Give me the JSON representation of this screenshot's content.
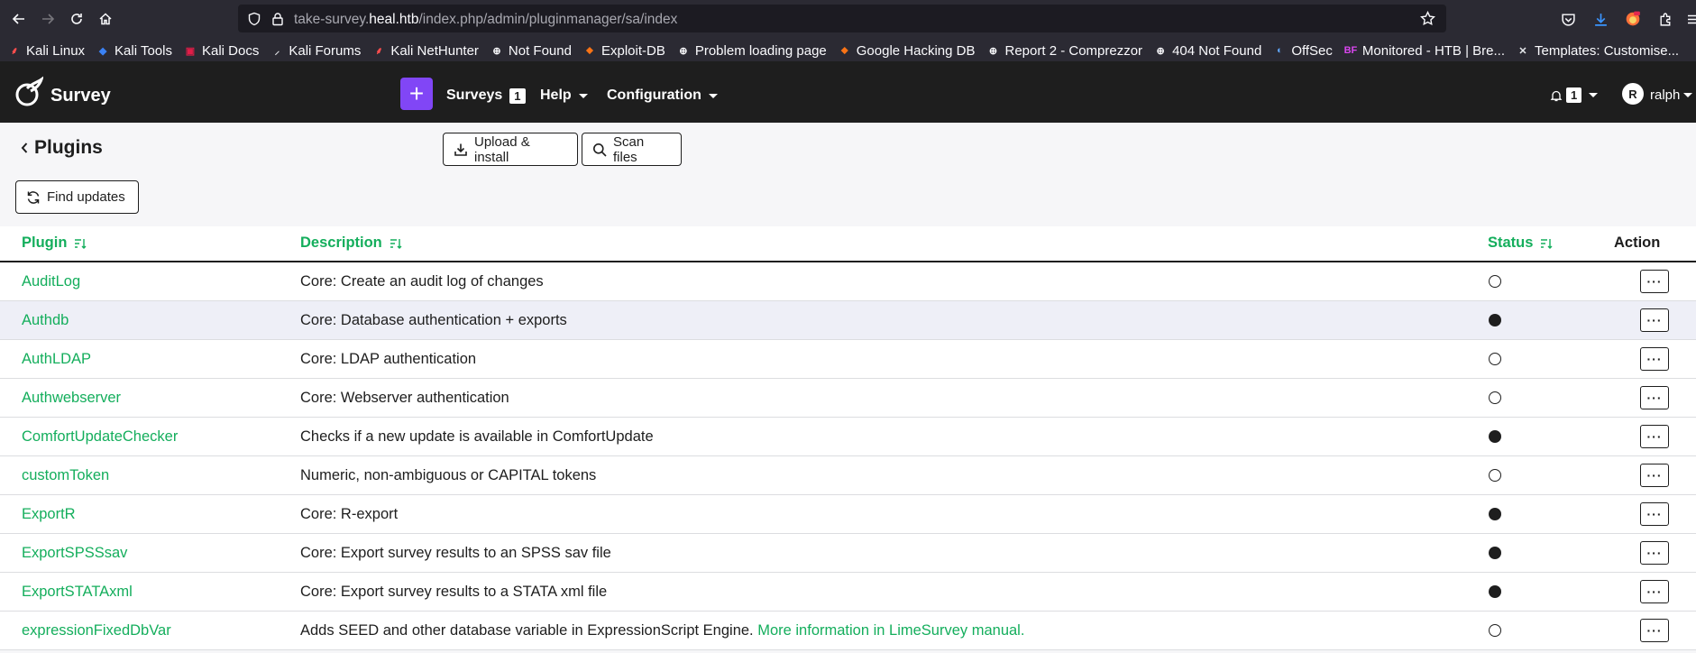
{
  "browser": {
    "url_prefix": "take-survey.",
    "url_host": "heal.htb",
    "url_path": "/index.php/admin/pluginmanager/sa/index",
    "bookmarks": [
      {
        "label": "Kali Linux",
        "icon": "kali-dragon-icon"
      },
      {
        "label": "Kali Tools",
        "icon": "kali-tools-icon"
      },
      {
        "label": "Kali Docs",
        "icon": "kali-docs-icon"
      },
      {
        "label": "Kali Forums",
        "icon": "kali-forums-icon"
      },
      {
        "label": "Kali NetHunter",
        "icon": "kali-nethunter-icon"
      },
      {
        "label": "Not Found",
        "icon": "globe-icon"
      },
      {
        "label": "Exploit-DB",
        "icon": "exploit-db-icon"
      },
      {
        "label": "Problem loading page",
        "icon": "globe-icon"
      },
      {
        "label": "Google Hacking DB",
        "icon": "ghdb-icon"
      },
      {
        "label": "Report 2 - Comprezzor",
        "icon": "globe-icon"
      },
      {
        "label": "404 Not Found",
        "icon": "globe-icon"
      },
      {
        "label": "OffSec",
        "icon": "offsec-icon"
      },
      {
        "label": "Monitored - HTB | Bre...",
        "icon": "bf-icon"
      },
      {
        "label": "Templates: Customise...",
        "icon": "joomla-icon"
      }
    ]
  },
  "navbar": {
    "brand": "Survey",
    "add_label": "+",
    "surveys_label": "Surveys",
    "surveys_count": "1",
    "help_label": "Help",
    "configuration_label": "Configuration",
    "notifications_count": "1",
    "avatar_initial": "R",
    "user_name": "ralph"
  },
  "page": {
    "title": "Plugins",
    "upload_label": "Upload & install",
    "scan_label": "Scan files",
    "find_updates_label": "Find updates"
  },
  "table": {
    "headers": {
      "plugin": "Plugin",
      "description": "Description",
      "status": "Status",
      "action": "Action"
    },
    "action_label": "···",
    "rows": [
      {
        "plugin": "AuditLog",
        "description": "Core: Create an audit log of changes",
        "link": "",
        "active": false
      },
      {
        "plugin": "Authdb",
        "description": "Core: Database authentication + exports",
        "link": "",
        "active": true
      },
      {
        "plugin": "AuthLDAP",
        "description": "Core: LDAP authentication",
        "link": "",
        "active": false
      },
      {
        "plugin": "Authwebserver",
        "description": "Core: Webserver authentication",
        "link": "",
        "active": false
      },
      {
        "plugin": "ComfortUpdateChecker",
        "description": "Checks if a new update is available in ComfortUpdate",
        "link": "",
        "active": true
      },
      {
        "plugin": "customToken",
        "description": "Numeric, non-ambiguous or CAPITAL tokens",
        "link": "",
        "active": false
      },
      {
        "plugin": "ExportR",
        "description": "Core: R-export",
        "link": "",
        "active": true
      },
      {
        "plugin": "ExportSPSSsav",
        "description": "Core: Export survey results to an SPSS sav file",
        "link": "",
        "active": true
      },
      {
        "plugin": "ExportSTATAxml",
        "description": "Core: Export survey results to a STATA xml file",
        "link": "",
        "active": true
      },
      {
        "plugin": "expressionFixedDbVar",
        "description": "Adds SEED and other database variable in ExpressionScript Engine. ",
        "link": "More information in LimeSurvey manual.",
        "active": false
      }
    ]
  },
  "colors": {
    "accent_green": "#14ae5c",
    "add_purple": "#8146f6",
    "navbar_dark": "#1e1e1e",
    "browser_chrome": "#2b2a33"
  }
}
